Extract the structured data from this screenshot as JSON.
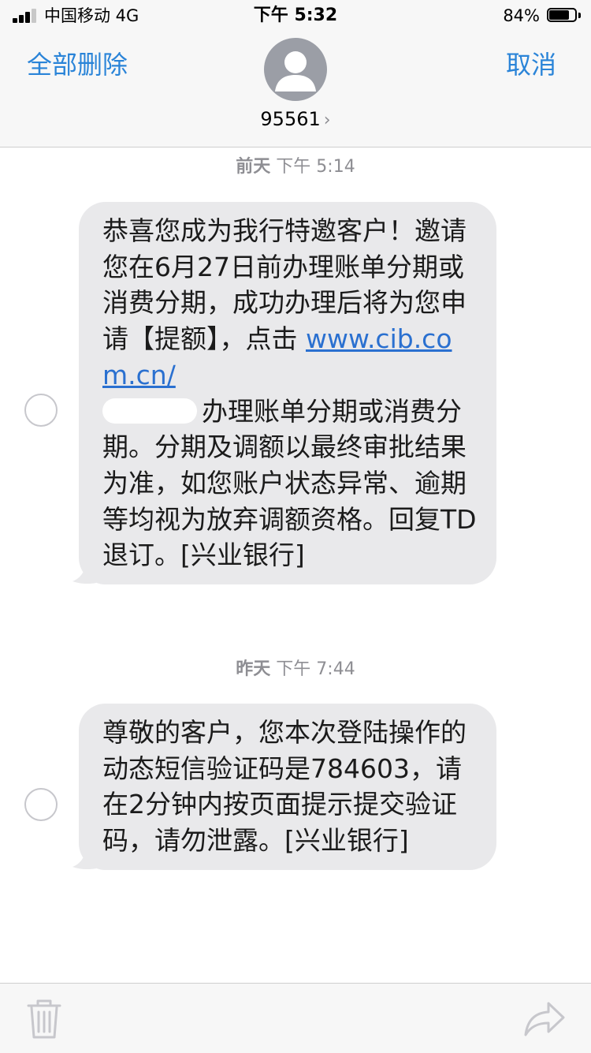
{
  "status_bar": {
    "carrier": "中国移动  4G",
    "time": "下午 5:32",
    "battery_percent": "84%",
    "battery_level": 0.84
  },
  "header": {
    "left_button": "全部删除",
    "right_button": "取消",
    "contact": "95561",
    "avatar_icon": "person-icon",
    "chevron_icon": "chevron-right-icon"
  },
  "messages": [
    {
      "timestamp_day": "前天",
      "timestamp_time": "下午 5:14",
      "text_part1": "恭喜您成为我行特邀客户！邀请您在6月27日前办理账单分期或消费分期，成功办理后将为您申请【提额】，点击 ",
      "link": "www.cib.com.cn/",
      "text_part2": "办理账单分期或消费分期。分期及调额以最终审批结果为准，如您账户状态异常、逾期等均视为放弃调额资格。回复TD退订。[兴业银行]"
    },
    {
      "timestamp_day": "昨天",
      "timestamp_time": "下午 7:44",
      "text": "尊敬的客户，您本次登陆操作的动态短信验证码是784603，请在2分钟内按页面提示提交验证码，请勿泄露。[兴业银行]"
    }
  ],
  "toolbar": {
    "delete_icon": "trash-icon",
    "forward_icon": "share-arrow-icon"
  },
  "colors": {
    "accent": "#2a84d8",
    "bubble": "#e9e9eb",
    "timestamp": "#8e8e93"
  }
}
